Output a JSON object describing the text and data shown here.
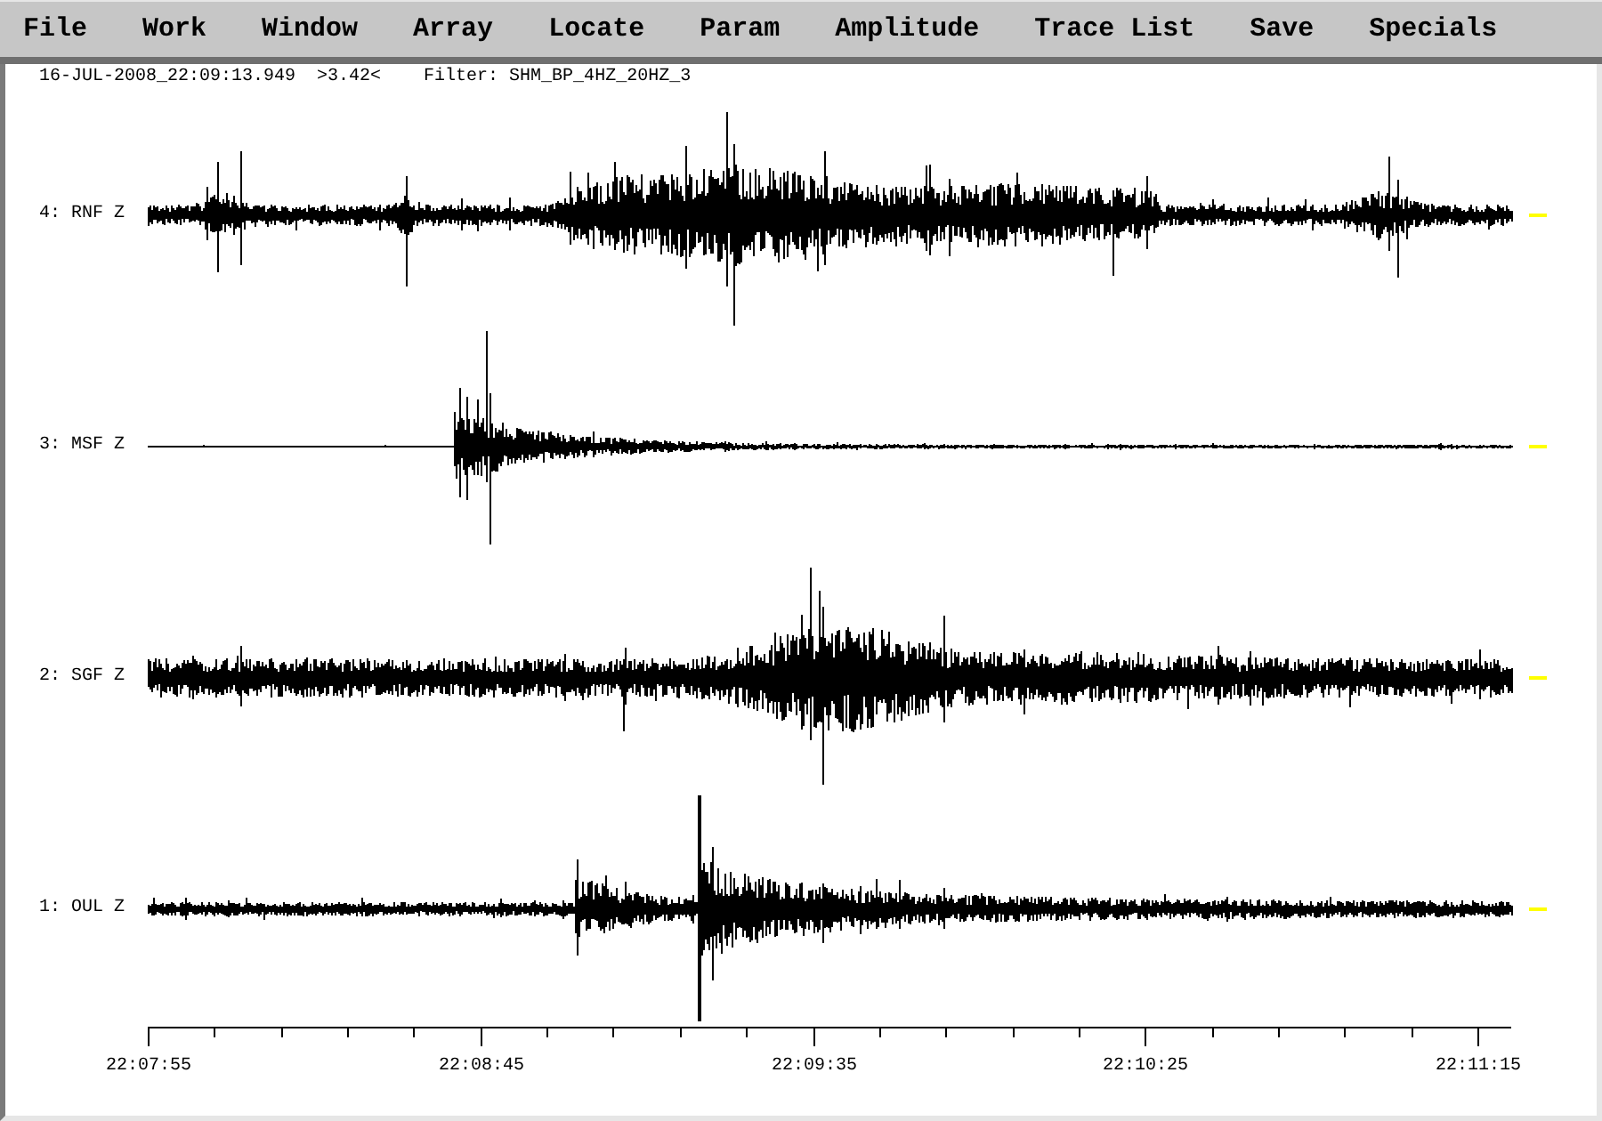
{
  "menu_bar": [
    "File",
    "Work",
    "Window",
    "Array",
    "Locate",
    "Param",
    "Amplitude",
    "Trace List",
    "Save",
    "Specials"
  ],
  "header": {
    "timestamp": "16-JUL-2008_22:09:13.949",
    "amplitude": ">3.42<",
    "filter": "Filter: SHM_BP_4HZ_20HZ_3"
  },
  "traces": [
    {
      "label": "4: RNF Z"
    },
    {
      "label": "3: MSF Z"
    },
    {
      "label": "2: SGF Z"
    },
    {
      "label": "1: OUL Z"
    }
  ],
  "time_axis": {
    "labels": [
      "22:07:55",
      "22:08:45",
      "22:09:35",
      "22:10:25",
      "22:11:15"
    ]
  }
}
